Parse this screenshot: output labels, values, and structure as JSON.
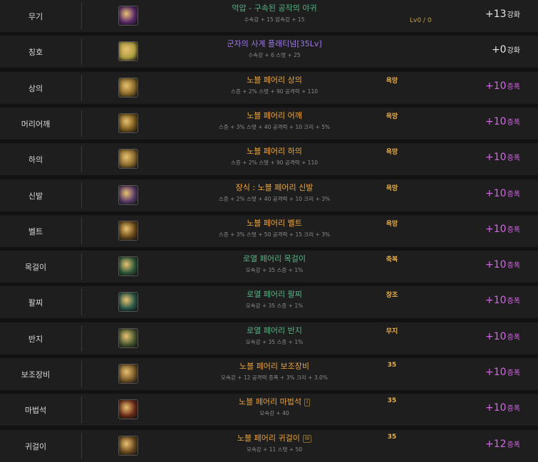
{
  "rows": [
    {
      "slot": "무기",
      "name": "억압 - 구속된 공작의 야귀",
      "name_color": "n-green",
      "stats": "수속강 + 15 암속강 + 15",
      "tag": "",
      "level_text": "Lv0 / 0",
      "badge": "",
      "enhance_value": "+13",
      "enhance_unit": "강화",
      "enhance_color": "c-white",
      "icon": "weapon-icon",
      "icon_bg": "#5a2a6e"
    },
    {
      "slot": "칭호",
      "name": "군자의 사계 플래티넘[35Lv]",
      "name_color": "n-purple",
      "stats": "수속강 + 6 스탯 + 25",
      "tag": "",
      "level_text": "",
      "badge": "",
      "enhance_value": "+0",
      "enhance_unit": "강화",
      "enhance_color": "c-white",
      "icon": "title-icon",
      "icon_bg": "#b0a040"
    },
    {
      "slot": "상의",
      "name": "노블 페어리 상의",
      "name_color": "n-orange",
      "stats": "스증 + 2% 스탯 + 90 공격력 + 110",
      "tag": "욕망",
      "level_text": "",
      "badge": "",
      "enhance_value": "+10",
      "enhance_unit": "증폭",
      "enhance_color": "c-purple",
      "icon": "top-armor-icon",
      "icon_bg": "#8a6a28"
    },
    {
      "slot": "머리어깨",
      "name": "노블 페어리 어깨",
      "name_color": "n-orange",
      "stats": "스증 + 3% 스탯 + 40 공격력 + 10 크리 + 5%",
      "tag": "욕망",
      "level_text": "",
      "badge": "",
      "enhance_value": "+10",
      "enhance_unit": "증폭",
      "enhance_color": "c-purple",
      "icon": "shoulder-armor-icon",
      "icon_bg": "#7a5a1e"
    },
    {
      "slot": "하의",
      "name": "노블 페어리 하의",
      "name_color": "n-orange",
      "stats": "스증 + 2% 스탯 + 90 공격력 + 110",
      "tag": "욕망",
      "level_text": "",
      "badge": "",
      "enhance_value": "+10",
      "enhance_unit": "증폭",
      "enhance_color": "c-purple",
      "icon": "bottom-armor-icon",
      "icon_bg": "#8a6a2e"
    },
    {
      "slot": "신발",
      "name": "장식 : 노블 페어리 신발",
      "name_color": "n-orange",
      "stats": "스증 + 2% 스탯 + 40 공격력 + 10 크리 + 3%",
      "tag": "욕망",
      "level_text": "",
      "badge": "",
      "enhance_value": "+10",
      "enhance_unit": "증폭",
      "enhance_color": "c-purple",
      "icon": "shoes-icon",
      "icon_bg": "#5a3a6a"
    },
    {
      "slot": "벨트",
      "name": "노블 페어리 벨트",
      "name_color": "n-orange",
      "stats": "스증 + 3% 스탯 + 50 공격력 + 15 크리 + 3%",
      "tag": "욕망",
      "level_text": "",
      "badge": "",
      "enhance_value": "+10",
      "enhance_unit": "증폭",
      "enhance_color": "c-purple",
      "icon": "belt-icon",
      "icon_bg": "#6a4a18"
    },
    {
      "slot": "목걸이",
      "name": "로열 페어리 목걸이",
      "name_color": "n-green",
      "stats": "모속강 + 35 스증 + 1%",
      "tag": "축복",
      "level_text": "",
      "badge": "",
      "enhance_value": "+10",
      "enhance_unit": "증폭",
      "enhance_color": "c-purple",
      "icon": "necklace-icon",
      "icon_bg": "#2e5a3a"
    },
    {
      "slot": "팔찌",
      "name": "로열 페어리 팔찌",
      "name_color": "n-green",
      "stats": "모속강 + 35 스증 + 1%",
      "tag": "창조",
      "level_text": "",
      "badge": "",
      "enhance_value": "+10",
      "enhance_unit": "증폭",
      "enhance_color": "c-purple",
      "icon": "bracelet-icon",
      "icon_bg": "#2a5a48"
    },
    {
      "slot": "반지",
      "name": "로열 페어리 반지",
      "name_color": "n-green",
      "stats": "모속강 + 35 스증 + 1%",
      "tag": "무지",
      "level_text": "",
      "badge": "",
      "enhance_value": "+10",
      "enhance_unit": "증폭",
      "enhance_color": "c-purple",
      "icon": "ring-icon",
      "icon_bg": "#4a5a30"
    },
    {
      "slot": "보조장비",
      "name": "노블 페어리 보조장비",
      "name_color": "n-gold",
      "stats": "모속강 + 12 공격력 증폭 + 3% 크리 + 3.0%",
      "tag": "35",
      "level_text": "",
      "badge": "",
      "enhance_value": "+10",
      "enhance_unit": "증폭",
      "enhance_color": "c-purple",
      "icon": "sub-equipment-icon",
      "icon_bg": "#7a5a28"
    },
    {
      "slot": "마법석",
      "name": "노블 페어리 마법석",
      "name_color": "n-gold",
      "stats": "모속강 + 40",
      "tag": "35",
      "level_text": "",
      "badge": "I",
      "enhance_value": "+10",
      "enhance_unit": "증폭",
      "enhance_color": "c-purple",
      "icon": "magic-stone-icon",
      "icon_bg": "#6a2a18"
    },
    {
      "slot": "귀걸이",
      "name": "노블 페어리 귀걸이",
      "name_color": "n-gold",
      "stats": "모속강 + 11 스탯 + 50",
      "tag": "35",
      "level_text": "",
      "badge": "III",
      "enhance_value": "+12",
      "enhance_unit": "증폭",
      "enhance_color": "c-purple",
      "icon": "earring-icon",
      "icon_bg": "#6a4a1e"
    }
  ]
}
